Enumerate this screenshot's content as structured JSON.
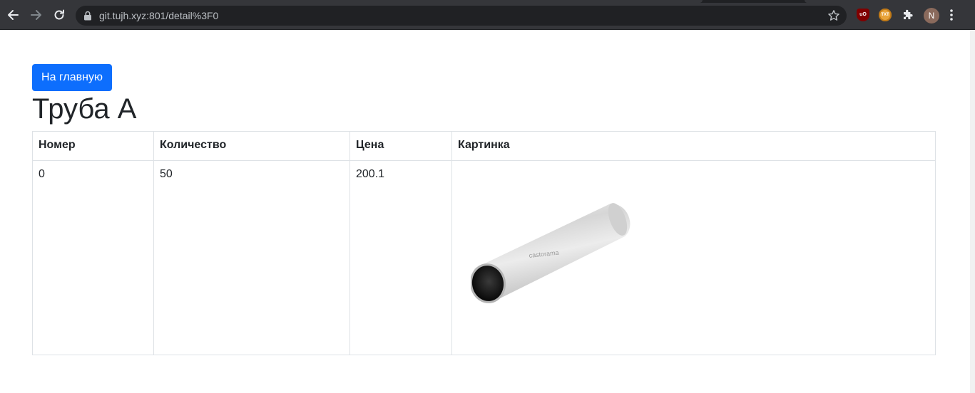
{
  "browser": {
    "url": "git.tujh.xyz:801/detail%3F0",
    "profile_initial": "N",
    "extensions": [
      {
        "name": "ublock-icon",
        "label": "uO"
      },
      {
        "name": "txt-extension-icon",
        "label": "TXT"
      },
      {
        "name": "puzzle-icon",
        "label": ""
      }
    ]
  },
  "page": {
    "home_button_label": "На главную",
    "title": "Труба А",
    "table": {
      "headers": [
        "Номер",
        "Количество",
        "Цена",
        "Картинка"
      ],
      "rows": [
        {
          "number": "0",
          "quantity": "50",
          "price": "200.1",
          "image_watermark": "castorama"
        }
      ]
    }
  },
  "colors": {
    "primary": "#0d6efd",
    "chrome_bg": "#35363a",
    "omnibox_bg": "#202124"
  }
}
